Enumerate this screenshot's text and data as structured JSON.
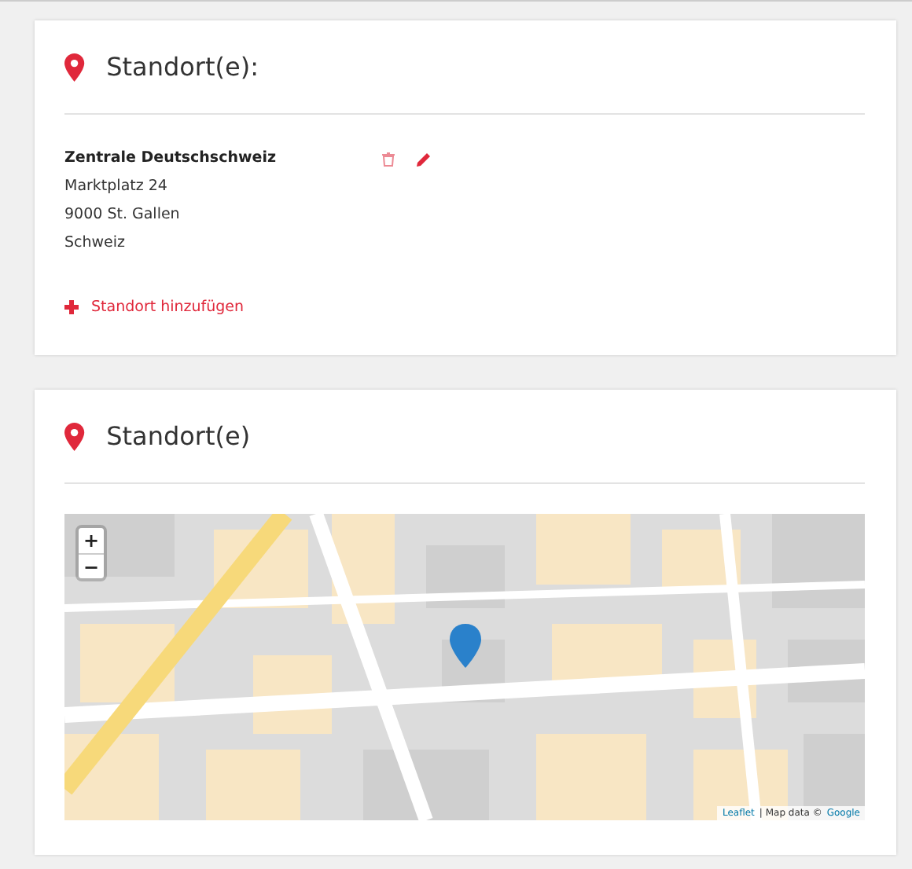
{
  "cards": [
    {
      "title": "Standort(e):",
      "kind": "list",
      "locations": [
        {
          "name": "Zentrale Deutschschweiz",
          "lines": [
            "Marktplatz 24",
            "9000 St. Gallen",
            "Schweiz"
          ]
        }
      ],
      "add_link": "Standort hinzufügen"
    },
    {
      "title": "Standort(e)",
      "kind": "map",
      "map": {
        "zoom_in": "+",
        "zoom_out": "−",
        "attribution": {
          "leaflet": "Leaflet",
          "separator": "| Map data ©",
          "provider": "Google"
        }
      }
    }
  ]
}
